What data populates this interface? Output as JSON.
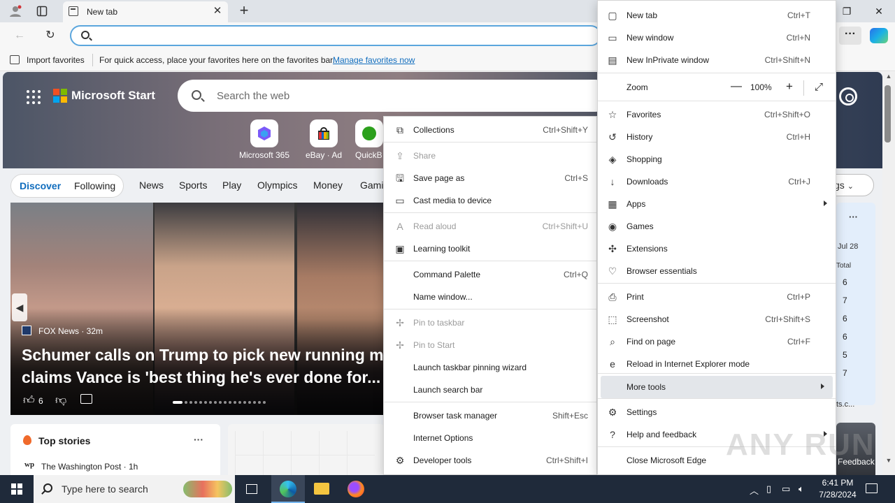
{
  "tab": {
    "title": "New tab"
  },
  "favorites_bar": {
    "import_label": "Import favorites",
    "hint": "For quick access, place your favorites here on the favorites bar.",
    "manage_link": "Manage favorites now"
  },
  "start_page": {
    "brand": "Microsoft Start",
    "search_placeholder": "Search the web",
    "quick_links": [
      "Microsoft 365",
      "eBay · Ad",
      "QuickB"
    ],
    "feed_tabs": [
      "Discover",
      "Following"
    ],
    "categories": [
      "News",
      "Sports",
      "Play",
      "Olympics",
      "Money",
      "Gami"
    ],
    "settings_pill": "gs",
    "carousel": {
      "source": "FOX News · 32m",
      "headline_line1": "Schumer calls on Trump to pick new running ma",
      "headline_line2": "claims Vance is 'best thing he's ever done for...",
      "likes": "6",
      "pager_count": 18
    },
    "top_stories": {
      "title": "Top stories",
      "more": "···",
      "source_logo": "wp",
      "source": "The Washington Post · 1h"
    },
    "right_card": {
      "more": "···",
      "date": "Jul 28",
      "total_label": "Total",
      "values": [
        "6",
        "7",
        "6",
        "6",
        "5",
        "7"
      ],
      "link": "ts.c...",
      "feedback": "Feedback"
    }
  },
  "more_tools_menu": [
    {
      "label": "Collections",
      "shortcut": "Ctrl+Shift+Y",
      "icon": "collections-icon",
      "disabled": false
    },
    {
      "label": "Share",
      "shortcut": "",
      "icon": "share-icon",
      "disabled": true
    },
    {
      "label": "Save page as",
      "shortcut": "Ctrl+S",
      "icon": "save-icon",
      "disabled": false
    },
    {
      "label": "Cast media to device",
      "shortcut": "",
      "icon": "cast-icon",
      "disabled": false
    },
    {
      "label": "Read aloud",
      "shortcut": "Ctrl+Shift+U",
      "icon": "read-aloud-icon",
      "disabled": true
    },
    {
      "label": "Learning toolkit",
      "shortcut": "",
      "icon": "learning-toolkit-icon",
      "disabled": false
    },
    {
      "label": "Command Palette",
      "shortcut": "Ctrl+Q",
      "icon": "",
      "disabled": false
    },
    {
      "label": "Name window...",
      "shortcut": "",
      "icon": "",
      "disabled": false
    },
    {
      "label": "Pin to taskbar",
      "shortcut": "",
      "icon": "pin-icon",
      "disabled": true
    },
    {
      "label": "Pin to Start",
      "shortcut": "",
      "icon": "pin-icon",
      "disabled": true
    },
    {
      "label": "Launch taskbar pinning wizard",
      "shortcut": "",
      "icon": "",
      "disabled": false
    },
    {
      "label": "Launch search bar",
      "shortcut": "",
      "icon": "",
      "disabled": false
    },
    {
      "label": "Browser task manager",
      "shortcut": "Shift+Esc",
      "icon": "",
      "disabled": false
    },
    {
      "label": "Internet Options",
      "shortcut": "",
      "icon": "",
      "disabled": false
    },
    {
      "label": "Developer tools",
      "shortcut": "Ctrl+Shift+I",
      "icon": "developer-tools-icon",
      "disabled": false
    }
  ],
  "main_menu": [
    {
      "label": "New tab",
      "shortcut": "Ctrl+T",
      "icon": "new-tab-icon"
    },
    {
      "label": "New window",
      "shortcut": "Ctrl+N",
      "icon": "new-window-icon"
    },
    {
      "label": "New InPrivate window",
      "shortcut": "Ctrl+Shift+N",
      "icon": "inprivate-icon"
    },
    {
      "label": "Favorites",
      "shortcut": "Ctrl+Shift+O",
      "icon": "favorites-icon"
    },
    {
      "label": "History",
      "shortcut": "Ctrl+H",
      "icon": "history-icon"
    },
    {
      "label": "Shopping",
      "shortcut": "",
      "icon": "shopping-icon"
    },
    {
      "label": "Downloads",
      "shortcut": "Ctrl+J",
      "icon": "downloads-icon"
    },
    {
      "label": "Apps",
      "shortcut": "",
      "icon": "apps-icon"
    },
    {
      "label": "Games",
      "shortcut": "",
      "icon": "games-icon"
    },
    {
      "label": "Extensions",
      "shortcut": "",
      "icon": "extensions-icon"
    },
    {
      "label": "Browser essentials",
      "shortcut": "",
      "icon": "browser-essentials-icon"
    },
    {
      "label": "Print",
      "shortcut": "Ctrl+P",
      "icon": "print-icon"
    },
    {
      "label": "Screenshot",
      "shortcut": "Ctrl+Shift+S",
      "icon": "screenshot-icon"
    },
    {
      "label": "Find on page",
      "shortcut": "Ctrl+F",
      "icon": "find-icon"
    },
    {
      "label": "Reload in Internet Explorer mode",
      "shortcut": "",
      "icon": "ie-mode-icon"
    },
    {
      "label": "More tools",
      "shortcut": "",
      "icon": ""
    },
    {
      "label": "Settings",
      "shortcut": "",
      "icon": "settings-icon"
    },
    {
      "label": "Help and feedback",
      "shortcut": "",
      "icon": "help-icon"
    },
    {
      "label": "Close Microsoft Edge",
      "shortcut": "",
      "icon": ""
    }
  ],
  "zoom": {
    "label": "Zoom",
    "value": "100%",
    "minus": "—",
    "plus": "+"
  },
  "watermark": "ANY RUN",
  "taskbar": {
    "search_placeholder": "Type here to search",
    "time": "6:41 PM",
    "date": "7/28/2024"
  }
}
